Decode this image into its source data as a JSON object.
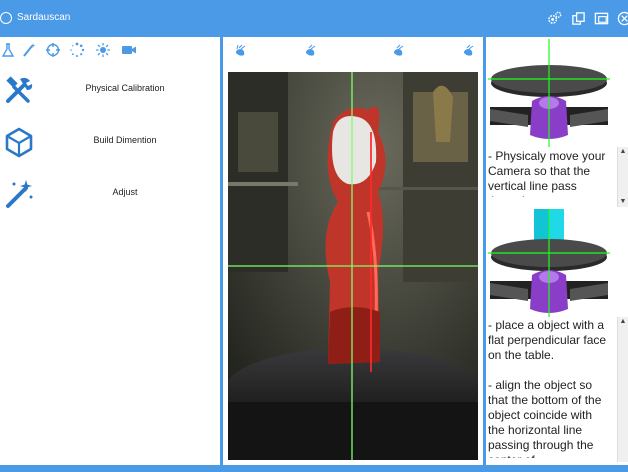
{
  "window": {
    "title": "Sardauscan"
  },
  "titlebar_icons": [
    "settings-gears-icon",
    "copy-icon",
    "frame-icon",
    "close-circle-icon"
  ],
  "left_toolbar": [
    "flask-icon",
    "wand-icon",
    "crosshair-icon",
    "spinner-icon",
    "sun-icon",
    "video-camera-icon"
  ],
  "menu": [
    {
      "label": "Physical Calibration",
      "icon": "wrench-hammer-icon"
    },
    {
      "label": "Build Dimention",
      "icon": "cube-icon"
    },
    {
      "label": "Adjust",
      "icon": "magic-wand-icon"
    }
  ],
  "camera_toolbar": [
    "laser-1-icon",
    "laser-2-icon",
    "laser-3-icon",
    "laser-4-icon"
  ],
  "instructions": [
    {
      "text": "- Physicaly move your Camera so that the vertical line pass through"
    },
    {
      "text": "- place a object with a flat perpendicular face on the table."
    },
    {
      "text": "- align the object so that the bottom of the object coincide with the horizontal line passing through the center of"
    }
  ],
  "colors": {
    "accent": "#4a9ae8",
    "guide_line": "#7dff6a",
    "laser": "#ff2a2a"
  }
}
